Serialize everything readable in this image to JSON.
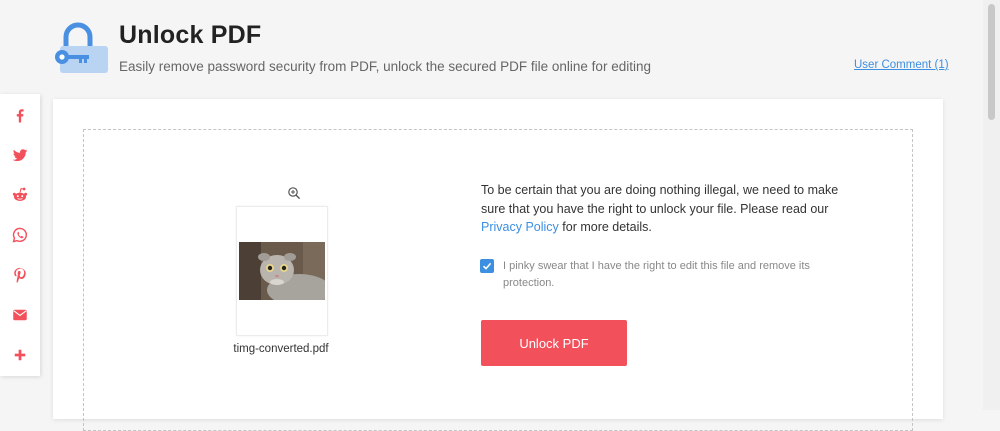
{
  "header": {
    "title": "Unlock PDF",
    "subtitle": "Easily remove password security from PDF, unlock the secured PDF file online for editing",
    "comment_link": "User Comment (1)",
    "icon": "lock-key-icon"
  },
  "share": {
    "items": [
      {
        "name": "facebook-icon",
        "color": "#f2515c"
      },
      {
        "name": "twitter-icon",
        "color": "#f2515c"
      },
      {
        "name": "reddit-icon",
        "color": "#f2515c"
      },
      {
        "name": "whatsapp-icon",
        "color": "#f2515c"
      },
      {
        "name": "pinterest-icon",
        "color": "#f2515c"
      },
      {
        "name": "email-icon",
        "color": "#f2515c"
      },
      {
        "name": "plus-icon",
        "color": "#f2515c"
      }
    ]
  },
  "file": {
    "name": "timg-converted.pdf",
    "thumbnail": "cat-photo"
  },
  "notice": {
    "text_before": "To be certain that you are doing nothing illegal, we need to make sure that you have the right to unlock your file. Please read our ",
    "link": "Privacy Policy",
    "text_after": " for more details."
  },
  "consent": {
    "checked": true,
    "label": "I pinky swear that I have the right to edit this file and remove its protection."
  },
  "action": {
    "button_label": "Unlock PDF"
  },
  "colors": {
    "accent": "#f2515c",
    "link": "#3d8fe0",
    "icon_blue": "#4a90e2"
  }
}
